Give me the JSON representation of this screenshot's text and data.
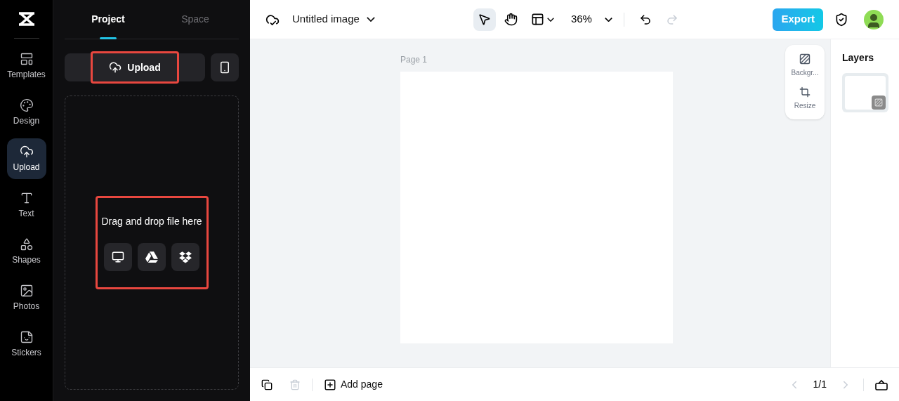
{
  "rail": [
    {
      "label": "Templates",
      "kind": "templates",
      "selected": false
    },
    {
      "label": "Design",
      "kind": "design",
      "selected": false
    },
    {
      "label": "Upload",
      "kind": "upload",
      "selected": true
    },
    {
      "label": "Text",
      "kind": "text",
      "selected": false
    },
    {
      "label": "Shapes",
      "kind": "shapes",
      "selected": false
    },
    {
      "label": "Photos",
      "kind": "photos",
      "selected": false
    },
    {
      "label": "Stickers",
      "kind": "stickers",
      "selected": false
    }
  ],
  "panel": {
    "tabs": [
      {
        "label": "Project",
        "selected": true
      },
      {
        "label": "Space",
        "selected": false
      }
    ],
    "upload_button": {
      "label": "Upload",
      "highlighted": true
    },
    "drop_zone": {
      "text": "Drag and drop file here",
      "highlighted": true,
      "sources": [
        {
          "kind": "computer"
        },
        {
          "kind": "drive"
        },
        {
          "kind": "dropbox"
        }
      ]
    }
  },
  "toolbar": {
    "title": "Untitled image",
    "tools": [
      {
        "kind": "pointer",
        "selected": true
      },
      {
        "kind": "hand",
        "selected": false
      }
    ],
    "zoom": "36%",
    "redo_disabled": true,
    "export": "Export"
  },
  "canvas": {
    "page_label": "Page 1"
  },
  "floating": [
    {
      "label": "Backgr...",
      "kind": "background"
    },
    {
      "label": "Resize",
      "kind": "resize"
    }
  ],
  "layers": {
    "title": "Layers"
  },
  "bottom": {
    "add_page": "Add page",
    "delete_disabled": true,
    "pager": "1/1"
  }
}
